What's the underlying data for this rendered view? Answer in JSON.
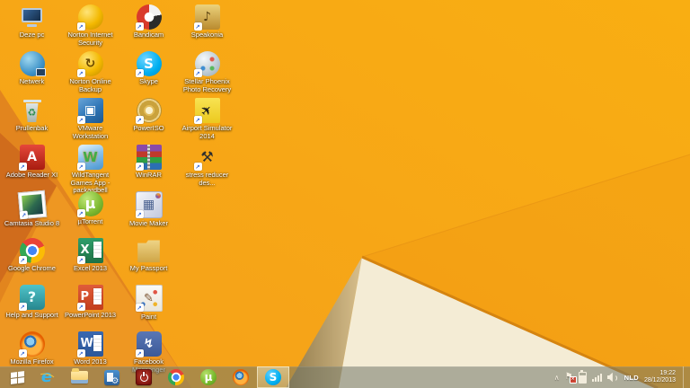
{
  "wallpaper": {
    "base_color": "#F7A714",
    "facet_dark": "#E2851E",
    "facet_darker": "#D06C1C",
    "facet_wedge": "#EE9722",
    "cream_triangle": "#F4ECD5",
    "tan_facet": "#C9AD76",
    "ridge_line": "#D58410"
  },
  "desktop": {
    "icons": [
      {
        "label": "Deze pc",
        "glyph": ""
      },
      {
        "label": "Norton Internet Security",
        "glyph": ""
      },
      {
        "label": "Bandicam",
        "glyph": ""
      },
      {
        "label": "Speakonia",
        "glyph": "♪"
      },
      {
        "label": "Netwerk",
        "glyph": ""
      },
      {
        "label": "Norton Online Backup",
        "glyph": "↻"
      },
      {
        "label": "Skype",
        "glyph": "S"
      },
      {
        "label": "Stellar Phoenix Photo Recovery",
        "glyph": ""
      },
      {
        "label": "Prullenbak",
        "glyph": "♻"
      },
      {
        "label": "VMware Workstation",
        "glyph": "▣"
      },
      {
        "label": "PowerISO",
        "glyph": ""
      },
      {
        "label": "Airport Simulator 2014",
        "glyph": "✈"
      },
      {
        "label": "Adobe Reader XI",
        "glyph": "A"
      },
      {
        "label": "WildTangent Games App - packardbell",
        "glyph": "W"
      },
      {
        "label": "WinRAR",
        "glyph": ""
      },
      {
        "label": "stress reducer des...",
        "glyph": "⚒"
      },
      {
        "label": "Camtasia Studio 8",
        "glyph": ""
      },
      {
        "label": "µTorrent",
        "glyph": "µ"
      },
      {
        "label": "Movie Maker",
        "glyph": "▦"
      },
      {
        "label": "Google Chrome",
        "glyph": ""
      },
      {
        "label": "Excel 2013",
        "glyph": "X"
      },
      {
        "label": "My Passport",
        "glyph": ""
      },
      {
        "label": "Help and Support",
        "glyph": "?"
      },
      {
        "label": "PowerPoint 2013",
        "glyph": "P"
      },
      {
        "label": "Paint",
        "glyph": "✎"
      },
      {
        "label": "Mozilla Firefox",
        "glyph": ""
      },
      {
        "label": "Word 2013",
        "glyph": "W"
      },
      {
        "label": "Facebook Messenger",
        "glyph": "↯"
      }
    ]
  },
  "taskbar": {
    "apps": [
      {
        "name": "internet-explorer",
        "glyph": "e"
      },
      {
        "name": "file-explorer",
        "glyph": ""
      },
      {
        "name": "system-settings",
        "glyph": "⚙"
      },
      {
        "name": "shutdown",
        "glyph": ""
      },
      {
        "name": "google-chrome",
        "glyph": ""
      },
      {
        "name": "utorrent",
        "glyph": "µ"
      },
      {
        "name": "firefox",
        "glyph": ""
      },
      {
        "name": "skype",
        "glyph": "S",
        "active": true
      }
    ],
    "tray": {
      "chevron_glyph": "∧",
      "flag_glyph": "⚑",
      "language": "NLD",
      "time": "19:22",
      "date": "28/12/2013"
    }
  }
}
